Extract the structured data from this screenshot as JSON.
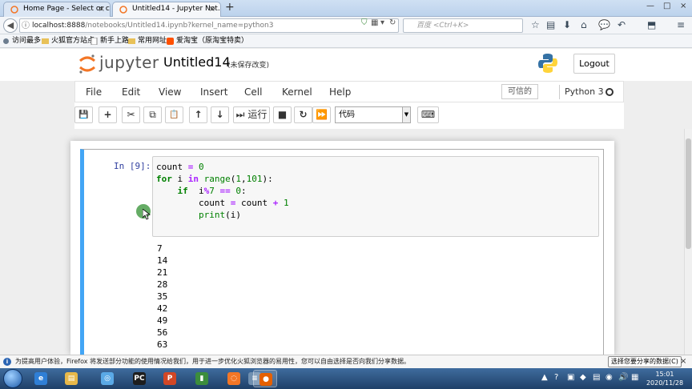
{
  "browser": {
    "tabs": [
      {
        "title": "Home Page - Select or c...",
        "close": "×",
        "active": false
      },
      {
        "title": "Untitled14 - Jupyter Not...",
        "close": "×",
        "active": true
      }
    ],
    "new_tab": "+",
    "window_controls": [
      "—",
      "□",
      "×"
    ],
    "url_host": "localhost:8888",
    "url_path": "/notebooks/Untitled14.ipynb?kernel_name=python3",
    "search_placeholder": "百度 <Ctrl+K>",
    "bookmarks": [
      "访问最多",
      "火狐官方站点",
      "新手上路",
      "常用网址",
      "爱淘宝（原淘宝特卖）"
    ]
  },
  "jupyter": {
    "logo_text": "jupyter",
    "notebook_title": "Untitled14",
    "unsaved_status": "(未保存改变)",
    "logout_label": "Logout",
    "menu": [
      "File",
      "Edit",
      "View",
      "Insert",
      "Cell",
      "Kernel",
      "Help"
    ],
    "trusted_label": "可信的",
    "kernel_name": "Python 3",
    "toolbar": {
      "save": "💾",
      "add": "+",
      "cut": "✂",
      "copy": "⧉",
      "paste": "📋",
      "up": "↑",
      "down": "↓",
      "run_icon": "⏭",
      "run_label": "运行",
      "stop": "■",
      "restart": "↻",
      "fast_forward": "⏩",
      "cell_type": "代码",
      "keyboard": "⌨"
    }
  },
  "cell": {
    "prompt": "In [9]:",
    "code_lines": [
      [
        {
          "t": "count ",
          "c": ""
        },
        {
          "t": "=",
          "c": "op"
        },
        {
          "t": " ",
          "c": ""
        },
        {
          "t": "0",
          "c": "num"
        }
      ],
      [
        {
          "t": "for",
          "c": "kw"
        },
        {
          "t": " i ",
          "c": ""
        },
        {
          "t": "in",
          "c": "op"
        },
        {
          "t": " ",
          "c": ""
        },
        {
          "t": "range",
          "c": "bi"
        },
        {
          "t": "(",
          "c": ""
        },
        {
          "t": "1",
          "c": "num"
        },
        {
          "t": ",",
          "c": ""
        },
        {
          "t": "101",
          "c": "num"
        },
        {
          "t": "):",
          "c": ""
        }
      ],
      [
        {
          "t": "    ",
          "c": ""
        },
        {
          "t": "if",
          "c": "kw"
        },
        {
          "t": "  i",
          "c": ""
        },
        {
          "t": "%",
          "c": "op"
        },
        {
          "t": "7",
          "c": "num"
        },
        {
          "t": " ",
          "c": ""
        },
        {
          "t": "==",
          "c": "op"
        },
        {
          "t": " ",
          "c": ""
        },
        {
          "t": "0",
          "c": "num"
        },
        {
          "t": ":",
          "c": ""
        }
      ],
      [
        {
          "t": "        count ",
          "c": ""
        },
        {
          "t": "=",
          "c": "op"
        },
        {
          "t": " count ",
          "c": ""
        },
        {
          "t": "+",
          "c": "op"
        },
        {
          "t": " ",
          "c": ""
        },
        {
          "t": "1",
          "c": "num"
        }
      ],
      [
        {
          "t": "        ",
          "c": ""
        },
        {
          "t": "print",
          "c": "bi"
        },
        {
          "t": "(i)",
          "c": ""
        }
      ]
    ],
    "output_lines": [
      "7",
      "14",
      "21",
      "28",
      "35",
      "42",
      "49",
      "56",
      "63"
    ]
  },
  "notification": {
    "info_icon": "i",
    "text": "为提高用户体验，Firefox 将发送部分功能的使用情况给我们，用于进一步优化火狐浏览器的易用性，您可以自由选择是否向我们分享数据。",
    "button": "选择您要分享的数据(C)",
    "close": "×"
  },
  "taskbar": {
    "apps": [
      {
        "name": "ie",
        "glyph": "e",
        "color": "#2f7fd6"
      },
      {
        "name": "explorer",
        "glyph": "▤",
        "color": "#e7b84a"
      },
      {
        "name": "network",
        "glyph": "◎",
        "color": "#5aa9e6"
      },
      {
        "name": "pycharm",
        "glyph": "PC",
        "color": "#1e1e1e"
      },
      {
        "name": "ppt",
        "glyph": "P",
        "color": "#d24726"
      },
      {
        "name": "chart-app",
        "glyph": "▮",
        "color": "#3c8d3c"
      },
      {
        "name": "jupyter",
        "glyph": "◌",
        "color": "#f37626"
      },
      {
        "name": "notepad",
        "glyph": "≡",
        "color": "#6f8fb0"
      },
      {
        "name": "firefox",
        "glyph": "●",
        "color": "#e66000"
      }
    ],
    "tray_icons": [
      "▲",
      "?",
      "▣",
      "◆",
      "▤",
      "◉",
      "🔊",
      "▦"
    ],
    "time": "15:01",
    "date": "2020/11/28"
  }
}
